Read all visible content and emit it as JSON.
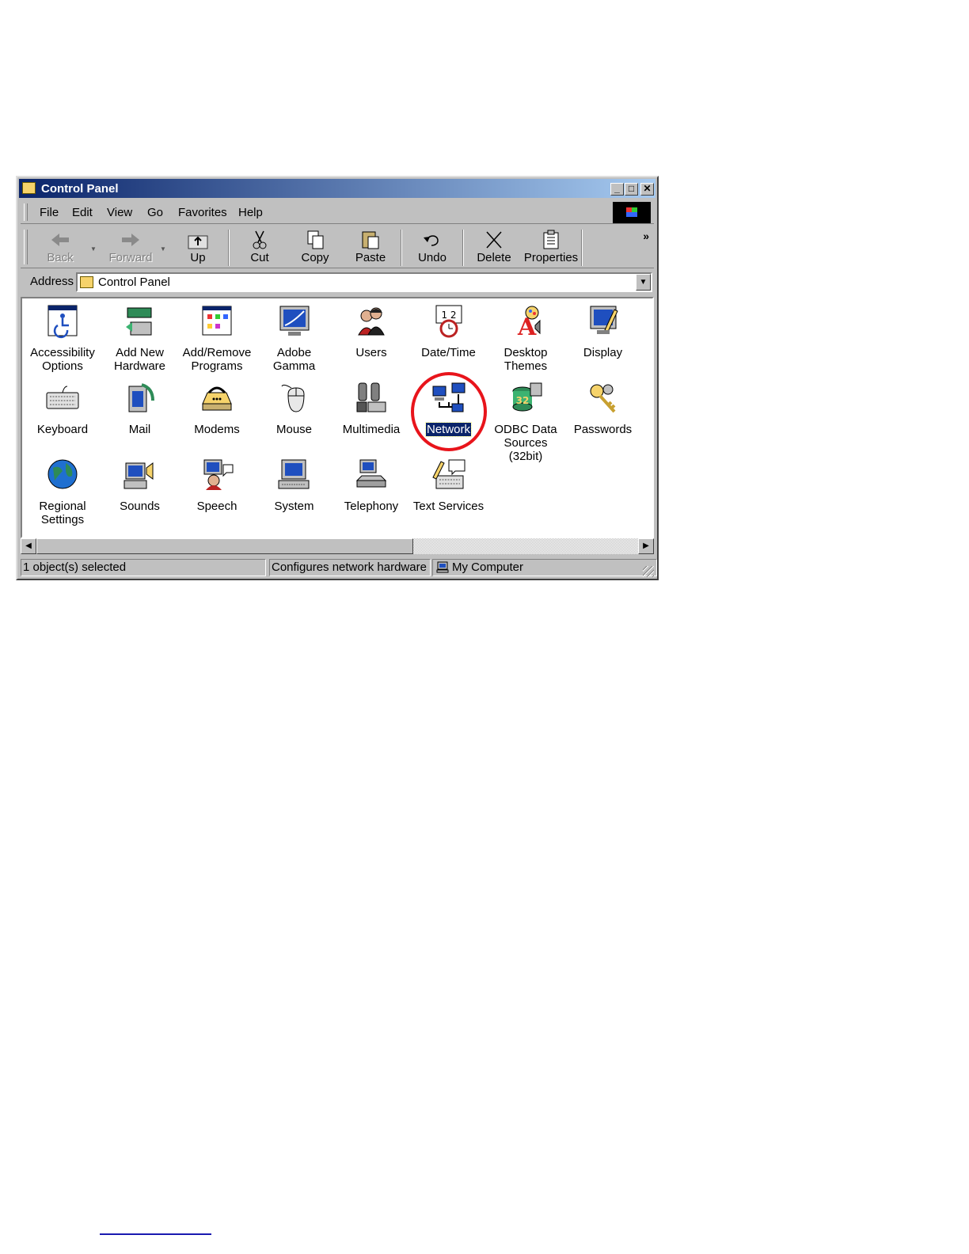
{
  "window": {
    "title": "Control Panel",
    "controls": {
      "minimize": "_",
      "maximize": "□",
      "close": "✕"
    }
  },
  "menu": [
    {
      "label": "File",
      "key": "F"
    },
    {
      "label": "Edit",
      "key": "E"
    },
    {
      "label": "View",
      "key": "V"
    },
    {
      "label": "Go",
      "key": "G"
    },
    {
      "label": "Favorites",
      "key": "a"
    },
    {
      "label": "Help",
      "key": "H"
    }
  ],
  "toolbar": {
    "back": "Back",
    "forward": "Forward",
    "up": "Up",
    "cut": "Cut",
    "copy": "Copy",
    "paste": "Paste",
    "undo": "Undo",
    "delete": "Delete",
    "properties": "Properties",
    "more": "»"
  },
  "address": {
    "label": "Address",
    "value": "Control Panel"
  },
  "items": [
    {
      "label": "Accessibility\nOptions",
      "icon": "accessibility-icon"
    },
    {
      "label": "Add New\nHardware",
      "icon": "add-hardware-icon"
    },
    {
      "label": "Add/Remove\nPrograms",
      "icon": "add-remove-programs-icon"
    },
    {
      "label": "Adobe Gamma",
      "icon": "adobe-gamma-icon"
    },
    {
      "label": "Users",
      "icon": "users-icon"
    },
    {
      "label": "Date/Time",
      "icon": "date-time-icon"
    },
    {
      "label": "Desktop\nThemes",
      "icon": "desktop-themes-icon"
    },
    {
      "label": "Display",
      "icon": "display-icon"
    },
    {
      "label": "Keyboard",
      "icon": "keyboard-icon"
    },
    {
      "label": "Mail",
      "icon": "mail-icon"
    },
    {
      "label": "Modems",
      "icon": "modems-icon"
    },
    {
      "label": "Mouse",
      "icon": "mouse-icon"
    },
    {
      "label": "Multimedia",
      "icon": "multimedia-icon"
    },
    {
      "label": "Network",
      "icon": "network-icon",
      "selected": true
    },
    {
      "label": "ODBC Data\nSources (32bit)",
      "icon": "odbc-icon"
    },
    {
      "label": "Passwords",
      "icon": "passwords-icon"
    },
    {
      "label": "Regional\nSettings",
      "icon": "regional-settings-icon"
    },
    {
      "label": "Sounds",
      "icon": "sounds-icon"
    },
    {
      "label": "Speech",
      "icon": "speech-icon"
    },
    {
      "label": "System",
      "icon": "system-icon"
    },
    {
      "label": "Telephony",
      "icon": "telephony-icon"
    },
    {
      "label": "Text Services",
      "icon": "text-services-icon"
    }
  ],
  "status": {
    "selection": "1 object(s) selected",
    "description": "Configures network hardware an",
    "zone": "My Computer"
  },
  "colors": {
    "title_gradient_start": "#0a246a",
    "title_gradient_end": "#a6caf0",
    "face": "#c0c0c0",
    "selection": "#0a246a",
    "highlight_ring": "#e8141b"
  }
}
